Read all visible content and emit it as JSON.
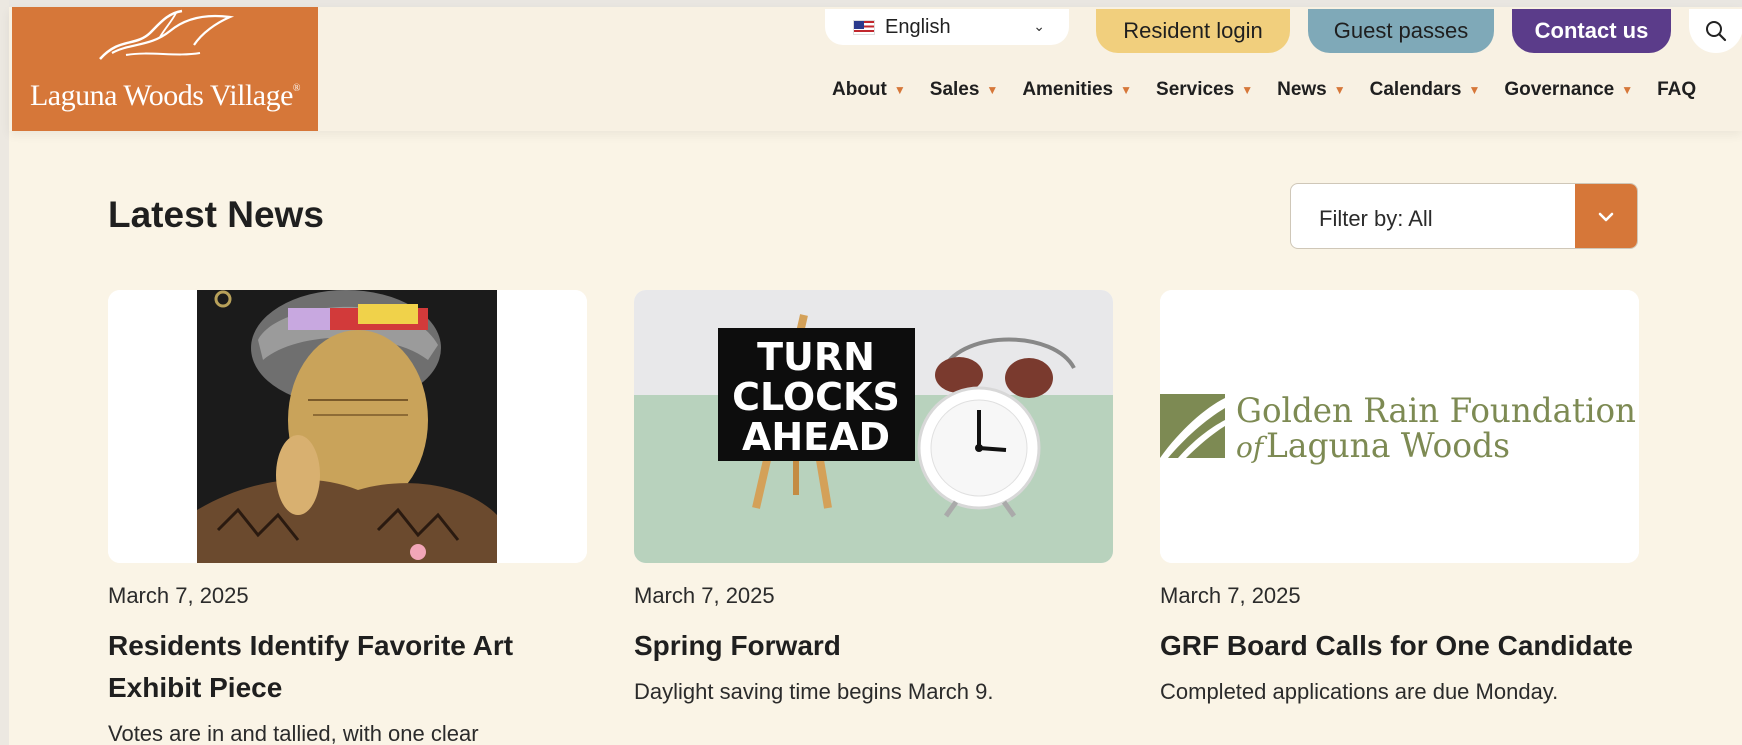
{
  "site": {
    "logo_text": "Laguna Woods Village",
    "language": "English"
  },
  "utility": {
    "resident_login": "Resident login",
    "guest_passes": "Guest passes",
    "contact_us": "Contact us"
  },
  "nav": [
    {
      "label": "About"
    },
    {
      "label": "Sales"
    },
    {
      "label": "Amenities"
    },
    {
      "label": "Services"
    },
    {
      "label": "News"
    },
    {
      "label": "Calendars"
    },
    {
      "label": "Governance"
    },
    {
      "label": "FAQ"
    }
  ],
  "page": {
    "title": "Latest News",
    "filter_label": "Filter by: All"
  },
  "cards": [
    {
      "date": "March 7, 2025",
      "title": "Residents Identify Favorite Art Exhibit Piece",
      "desc": "Votes are in and tallied, with one clear"
    },
    {
      "date": "March 7, 2025",
      "title": "Spring Forward",
      "desc": "Daylight saving time begins March 9.",
      "sign_lines": [
        "TURN",
        "CLOCKS",
        "AHEAD"
      ]
    },
    {
      "date": "March 7, 2025",
      "title": "GRF Board Calls for One Candidate",
      "desc": "Completed applications are due Monday.",
      "logo_line1": "Golden Rain Foundation",
      "logo_line2_prefix": "of",
      "logo_line2": "Laguna Woods"
    }
  ],
  "colors": {
    "brand_orange": "#d67739",
    "resident_yellow": "#f1cf7d",
    "guest_blue": "#7fa9b8",
    "contact_purple": "#5b3c8a",
    "page_bg": "#faf4e6",
    "grf_green": "#7d8a53"
  },
  "icons": {
    "search": "search-icon",
    "chevron": "chevron-down-icon",
    "nav_caret": "caret-down-icon"
  }
}
